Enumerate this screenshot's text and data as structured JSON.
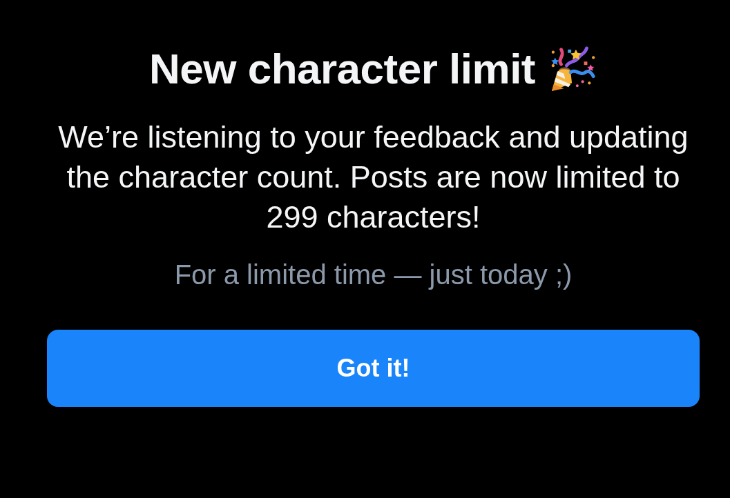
{
  "dialog": {
    "title": "New character limit",
    "message": "We’re listening to your feedback and updating the character count. Posts are now limited to 299 characters!",
    "note": "For a limited time — just today ;)",
    "button": "Got it!"
  }
}
